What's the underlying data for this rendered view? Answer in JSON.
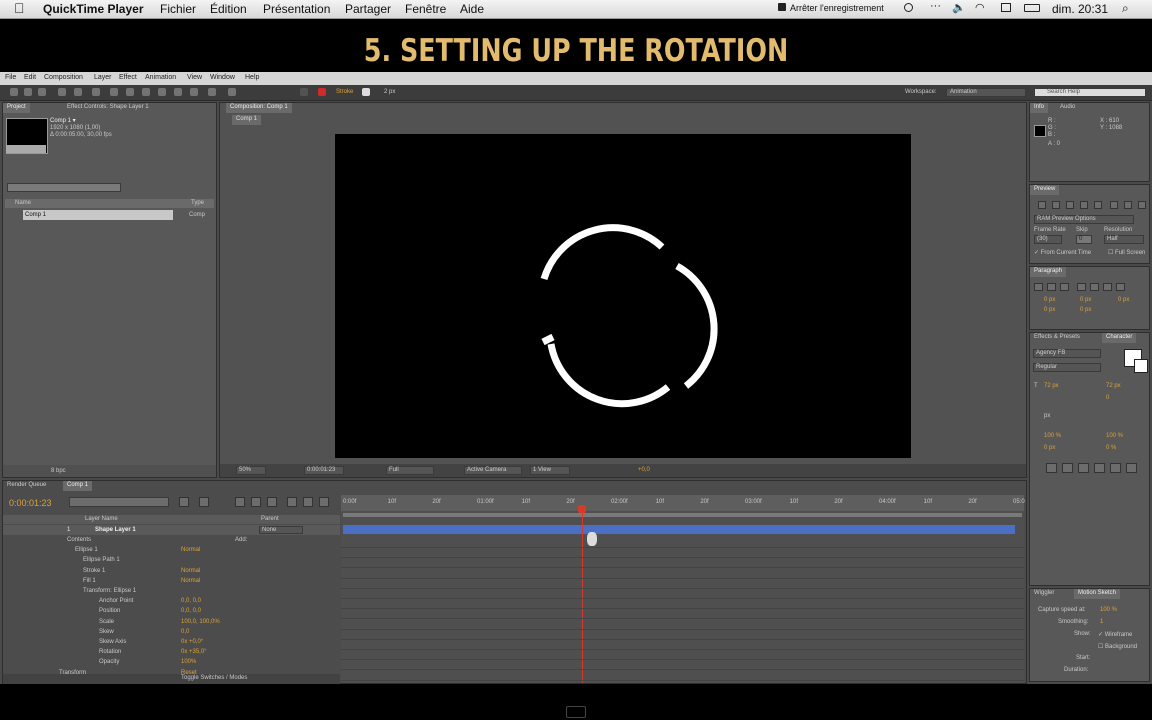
{
  "menubar": {
    "app": "QuickTime Player",
    "items": [
      "Fichier",
      "Édition",
      "Présentation",
      "Partager",
      "Fenêtre",
      "Aide"
    ],
    "record_label": "Arrêter l'enregistrement",
    "clock": "dim. 20:31"
  },
  "banner": "5. SETTING UP THE ROTATION",
  "ae_menu": [
    "File",
    "Edit",
    "Composition",
    "Layer",
    "Effect",
    "Animation",
    "View",
    "Window",
    "Help"
  ],
  "toolbar": {
    "workspace_label": "Workspace:",
    "workspace_value": "Animation",
    "search_placeholder": "Search Help",
    "stroke_label": "Stroke",
    "stroke_px": "2 px"
  },
  "project": {
    "tab_project": "Project",
    "tab_effect_controls": "Effect Controls: Shape Layer 1",
    "comp_name": "Comp 1 ▾",
    "comp_size": "1920 x 1080 (1,00)",
    "comp_duration": "Δ 0:00:05:00, 30,00 fps",
    "col_name": "Name",
    "col_type": "Type",
    "item_name": "Comp 1",
    "item_type": "Comp",
    "bpc": "8 bpc"
  },
  "composition": {
    "tab": "Composition: Comp 1",
    "breadcrumb": "Comp 1",
    "zoom": "50%",
    "timecode": "0:00:01:23",
    "resolution": "Full",
    "camera": "Active Camera",
    "views": "1 View",
    "offset": "+0,0"
  },
  "info": {
    "tab_info": "Info",
    "tab_audio": "Audio",
    "r": "R :",
    "g": "G :",
    "b": "B :",
    "a": "A : 0",
    "x": "X : 610",
    "y": "Y : 1088"
  },
  "preview": {
    "tab": "Preview",
    "ram_options": "RAM Preview Options",
    "frame_rate_label": "Frame Rate",
    "skip_label": "Skip",
    "resolution_label": "Resolution",
    "frame_rate_value": "(30)",
    "skip_value": "0",
    "resolution_value": "Half",
    "from_current": "From Current Time",
    "full_screen": "Full Screen"
  },
  "paragraph": {
    "tab": "Paragraph",
    "v1": "0 px",
    "v2": "0 px",
    "v3": "0 px",
    "v4": "0 px",
    "v5": "0 px"
  },
  "character": {
    "tab_effects": "Effects & Presets",
    "tab_character": "Character",
    "font": "Agency FB",
    "style": "Regular",
    "size": "72 px",
    "leading": "72 px",
    "tracking": "0",
    "stroke": "px",
    "vscale": "100 %",
    "hscale": "100 %",
    "baseline": "0 px",
    "tsume": "0 %"
  },
  "motion_sketch": {
    "tab_wiggler": "Wiggler",
    "tab_sketch": "Motion Sketch",
    "capture_label": "Capture speed at:",
    "capture_value": "100 %",
    "smoothing_label": "Smoothing:",
    "smoothing_value": "1",
    "show_label": "Show:",
    "wireframe": "Wireframe",
    "background": "Background",
    "start_label": "Start:",
    "duration_label": "Duration:"
  },
  "timeline": {
    "tab_render": "Render Queue",
    "tab_comp": "Comp 1",
    "current_time": "0:00:01:23",
    "col_layer_name": "Layer Name",
    "col_parent": "Parent",
    "parent_value": "None",
    "layer_num": "1",
    "layer_name": "Shape Layer 1",
    "add_label": "Add:",
    "toggle_label": "Toggle Switches / Modes",
    "ruler": [
      "0:00f",
      "10f",
      "20f",
      "01:00f",
      "10f",
      "20f",
      "02:00f",
      "10f",
      "20f",
      "03:00f",
      "10f",
      "20f",
      "04:00f",
      "10f",
      "20f",
      "05:0"
    ],
    "properties": [
      {
        "label": "Contents",
        "value": ""
      },
      {
        "label": "Ellipse 1",
        "value": "Normal"
      },
      {
        "label": "Ellipse Path 1",
        "value": ""
      },
      {
        "label": "Stroke 1",
        "value": "Normal"
      },
      {
        "label": "Fill 1",
        "value": "Normal"
      },
      {
        "label": "Transform: Ellipse 1",
        "value": ""
      },
      {
        "label": "Anchor Point",
        "value": "0,0, 0,0"
      },
      {
        "label": "Position",
        "value": "0,0, 0,0"
      },
      {
        "label": "Scale",
        "value": "100,0, 100,0%"
      },
      {
        "label": "Skew",
        "value": "0,0"
      },
      {
        "label": "Skew Axis",
        "value": "0x +0,0°"
      },
      {
        "label": "Rotation",
        "value": "0x +35,0°"
      },
      {
        "label": "Opacity",
        "value": "100%"
      },
      {
        "label": "Transform",
        "value": "Reset"
      }
    ]
  },
  "colors": {
    "banner": "#e3bb6e",
    "accent_orange": "#d8a33a",
    "layer_bar": "#4a6fc4",
    "playhead": "#d83a2a"
  }
}
